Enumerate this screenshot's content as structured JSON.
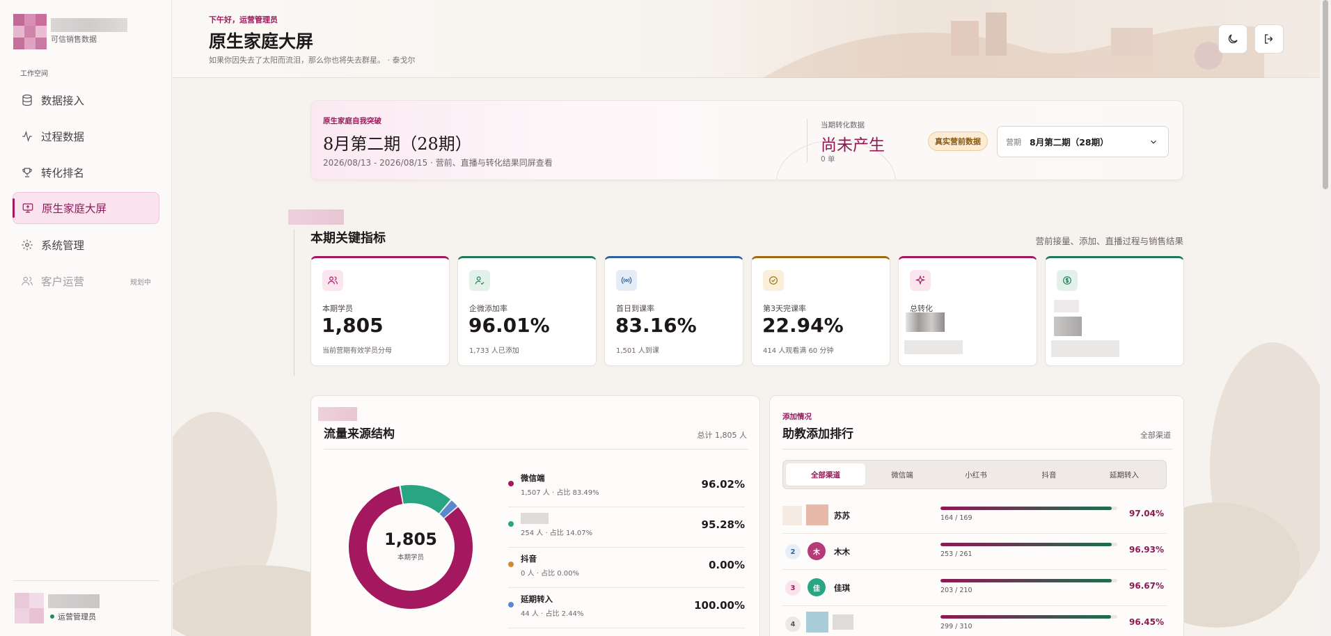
{
  "sidebar": {
    "brand_sub": "可信销售数据",
    "section_label": "工作空间",
    "items": [
      {
        "label": "数据接入",
        "icon": "database-icon"
      },
      {
        "label": "过程数据",
        "icon": "activity-icon"
      },
      {
        "label": "转化排名",
        "icon": "trophy-icon"
      },
      {
        "label": "原生家庭大屏",
        "icon": "monitor-icon"
      },
      {
        "label": "系统管理",
        "icon": "gear-icon"
      },
      {
        "label": "客户运营",
        "icon": "users-icon",
        "badge": "规划中"
      }
    ],
    "user_role": "运营管理员"
  },
  "header": {
    "greeting": "下午好，运营管理员",
    "title": "原生家庭大屏",
    "quote": "如果你因失去了太阳而流泪，那么你也将失去群星。 · 泰戈尔"
  },
  "period": {
    "tag": "原生家庭自我突破",
    "title": "8月第二期（28期）",
    "subtitle": "2026/08/13 - 2026/08/15 · 营前、直播与转化结果同屏查看",
    "conv_label": "当期转化数据",
    "conv_value": "尚未产生",
    "conv_unit": "0 单",
    "badge": "真实营前数据",
    "select_label": "营期",
    "select_value": "8月第二期（28期）"
  },
  "key_metrics": {
    "title": "本期关键指标",
    "desc": "营前接量、添加、直播过程与销售结果",
    "items": [
      {
        "label": "本期学员",
        "value": "1,805",
        "sub": "当前营期有效学员分母",
        "icon": "users-icon",
        "color": "#a3185e",
        "bg": "#fbe6ef"
      },
      {
        "label": "企微添加率",
        "value": "96.01%",
        "sub": "1,733 人已添加",
        "icon": "user-check-icon",
        "color": "#1e7a56",
        "bg": "#e2f2ea"
      },
      {
        "label": "首日到课率",
        "value": "83.16%",
        "sub": "1,501 人到课",
        "icon": "broadcast-icon",
        "color": "#2f5f9c",
        "bg": "#e4ecf6"
      },
      {
        "label": "第3天完课率",
        "value": "22.94%",
        "sub": "414 人观看满 60 分钟",
        "icon": "check-circle-icon",
        "color": "#a06a10",
        "bg": "#faefd8"
      },
      {
        "label": "总转化",
        "value": "",
        "sub": "",
        "icon": "sparkle-icon",
        "color": "#a3185e",
        "bg": "#fbe6ef"
      },
      {
        "label": "",
        "value": "",
        "sub": "",
        "icon": "dollar-icon",
        "color": "#1e7a56",
        "bg": "#e2f2ea"
      }
    ]
  },
  "traffic": {
    "title": "流量来源结构",
    "total_note": "总计 1,805 人",
    "center_value": "1,805",
    "center_label": "本期学员",
    "sources": [
      {
        "name": "微信端",
        "sub": "1,507 人 · 占比 83.49%",
        "pct": "96.02%",
        "color": "#a3185e"
      },
      {
        "name": "",
        "sub": "254 人 · 占比 14.07%",
        "pct": "95.28%",
        "color": "#2aa583"
      },
      {
        "name": "抖音",
        "sub": "0 人 · 占比 0.00%",
        "pct": "0.00%",
        "color": "#d28a3a"
      },
      {
        "name": "延期转入",
        "sub": "44 人 · 占比 2.44%",
        "pct": "100.00%",
        "color": "#5b86d0"
      }
    ],
    "chart_data": {
      "type": "pie",
      "categories": [
        "微信端",
        "",
        "抖音",
        "延期转入"
      ],
      "values": [
        1507,
        254,
        0,
        44
      ]
    }
  },
  "ranking": {
    "tag": "添加情况",
    "title": "助教添加排行",
    "note": "全部渠道",
    "tabs": [
      "全部渠道",
      "微信端",
      "小红书",
      "抖音",
      "延期转入"
    ],
    "rows": [
      {
        "rank": "",
        "avatar": "",
        "name": "苏苏",
        "count": "164 / 169",
        "pct": "97.04%",
        "fill": 0.9704,
        "avatar_color": "#e8b8a8"
      },
      {
        "rank": "2",
        "avatar": "木",
        "name": "木木",
        "count": "253 / 261",
        "pct": "96.93%",
        "fill": 0.9693,
        "avatar_color": "#b73a78"
      },
      {
        "rank": "3",
        "avatar": "佳",
        "name": "佳琪",
        "count": "203 / 210",
        "pct": "96.67%",
        "fill": 0.9667,
        "avatar_color": "#2aa583"
      },
      {
        "rank": "4",
        "avatar": "",
        "name": "",
        "count": "299 / 310",
        "pct": "96.45%",
        "fill": 0.9645,
        "avatar_color": "#a8ccd8"
      }
    ]
  }
}
